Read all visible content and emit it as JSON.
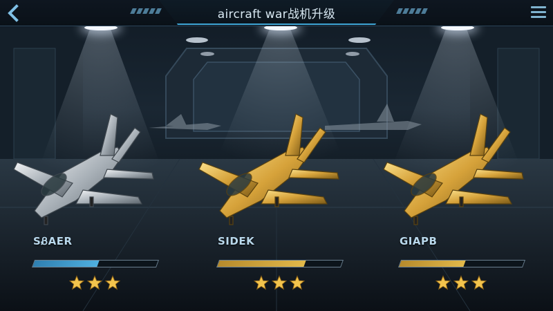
{
  "header": {
    "title": "aircraft war战机升级"
  },
  "colors": {
    "accent": "#3fa6d6",
    "gold": "#e2b94a",
    "blue_bar": "#4fb0e0",
    "star": "#f3c44d"
  },
  "icons": {
    "back": "chevron-left-icon",
    "menu": "hamburger-menu-icon",
    "star": "star-icon"
  },
  "planes": [
    {
      "name": "SᏰAER",
      "finish": "silver",
      "progress": 0.52,
      "stars": 3
    },
    {
      "name": "SIDEK",
      "finish": "gold",
      "progress": 0.7,
      "stars": 3
    },
    {
      "name": "GIAPB",
      "finish": "gold",
      "progress": 0.52,
      "stars": 3
    }
  ]
}
